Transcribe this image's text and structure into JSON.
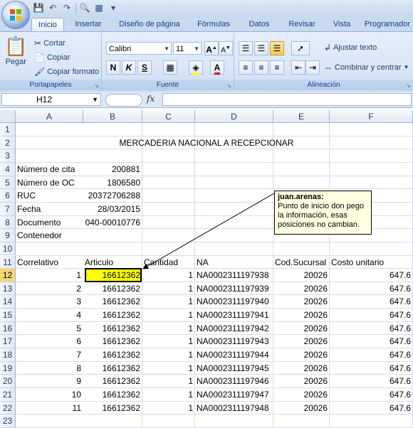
{
  "quick_access": {
    "icons": [
      "save-icon",
      "undo-icon",
      "redo-icon",
      "print-preview-icon",
      "chart-icon",
      "customize-icon"
    ]
  },
  "tabs": [
    "Inicio",
    "Insertar",
    "Diseño de página",
    "Fórmulas",
    "Datos",
    "Revisar",
    "Vista",
    "Programador"
  ],
  "active_tab": "Inicio",
  "ribbon": {
    "clipboard": {
      "label": "Portapapeles",
      "paste": "Pegar",
      "cut": "Cortar",
      "copy": "Copiar",
      "format_painter": "Copiar formato"
    },
    "font": {
      "label": "Fuente",
      "font_name": "Calibri",
      "font_size": "11",
      "bold": "N",
      "italic": "K",
      "underline": "S"
    },
    "alignment": {
      "label": "Alineación",
      "wrap_text": "Ajustar texto",
      "merge_center": "Combinar y centrar"
    }
  },
  "formula_bar": {
    "name_box": "H12",
    "fx": "fx",
    "formula": ""
  },
  "columns": [
    "A",
    "B",
    "C",
    "D",
    "E",
    "F"
  ],
  "rows": [
    "1",
    "2",
    "3",
    "4",
    "5",
    "6",
    "7",
    "8",
    "9",
    "10",
    "11",
    "12",
    "13",
    "14",
    "15",
    "16",
    "17",
    "18",
    "19",
    "20",
    "21",
    "22",
    "23"
  ],
  "sheet": {
    "title": "MERCADERIA NACIONAL A RECEPCIONAR",
    "info": [
      {
        "label": "Número de cita",
        "value": "200881"
      },
      {
        "label": "Número de OC",
        "value": "1806580"
      },
      {
        "label": "RUC",
        "value": "20372706288"
      },
      {
        "label": "Fecha",
        "value": "28/03/2015"
      },
      {
        "label": "Documento",
        "value": "040-00010776"
      },
      {
        "label": "Contenedor",
        "value": ""
      }
    ],
    "headers": [
      "Correlativo",
      "Articulo",
      "Cantidad",
      "NA",
      "Cod.Sucursal",
      "Costo unitario"
    ],
    "data": [
      [
        "1",
        "16612362",
        "1",
        "NA0002311197938",
        "20026",
        "647.6"
      ],
      [
        "2",
        "16612362",
        "1",
        "NA0002311197939",
        "20026",
        "647.6"
      ],
      [
        "3",
        "16612362",
        "1",
        "NA0002311197940",
        "20026",
        "647.6"
      ],
      [
        "4",
        "16612362",
        "1",
        "NA0002311197941",
        "20026",
        "647.6"
      ],
      [
        "5",
        "16612362",
        "1",
        "NA0002311197942",
        "20026",
        "647.6"
      ],
      [
        "6",
        "16612362",
        "1",
        "NA0002311197943",
        "20026",
        "647.6"
      ],
      [
        "7",
        "16612362",
        "1",
        "NA0002311197944",
        "20026",
        "647.6"
      ],
      [
        "8",
        "16612362",
        "1",
        "NA0002311197945",
        "20026",
        "647.6"
      ],
      [
        "9",
        "16612362",
        "1",
        "NA0002311197946",
        "20026",
        "647.6"
      ],
      [
        "10",
        "16612362",
        "1",
        "NA0002311197947",
        "20026",
        "647.6"
      ],
      [
        "11",
        "16612362",
        "1",
        "NA0002311197948",
        "20026",
        "647.6"
      ]
    ]
  },
  "comment": {
    "author": "juan.arenas:",
    "text": "Punto de inicio don pego la información, esas posiciones no cambian."
  },
  "colors": {
    "highlight": "#ffff00",
    "comment_bg": "#ffffe1",
    "ribbon": "#dbe7f7",
    "selected_header": "#f8d772"
  }
}
